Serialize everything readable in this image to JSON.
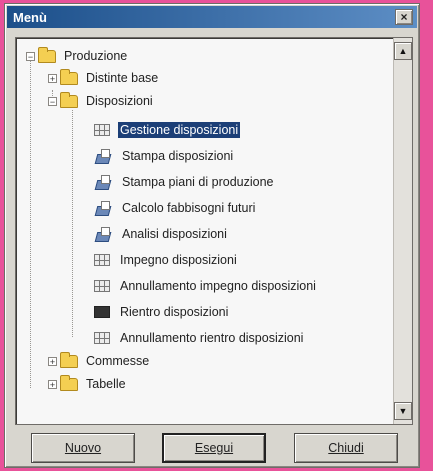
{
  "window": {
    "title": "Menù",
    "close_label": "×"
  },
  "tree": {
    "root": {
      "label": "Produzione",
      "expander": "−"
    },
    "distinte": {
      "label": "Distinte base",
      "expander": "+"
    },
    "disposizioni": {
      "label": "Disposizioni",
      "expander": "−"
    },
    "items": [
      {
        "label": "Gestione disposizioni",
        "icon": "grid-icon",
        "selected": true
      },
      {
        "label": "Stampa disposizioni",
        "icon": "print-icon"
      },
      {
        "label": "Stampa piani di produzione",
        "icon": "print-icon"
      },
      {
        "label": "Calcolo fabbisogni futuri",
        "icon": "print-icon"
      },
      {
        "label": "Analisi disposizioni",
        "icon": "print-icon"
      },
      {
        "label": "Impegno disposizioni",
        "icon": "grid-icon"
      },
      {
        "label": "Annullamento impegno disposizioni",
        "icon": "grid-icon"
      },
      {
        "label": "Rientro disposizioni",
        "icon": "dark-grid-icon"
      },
      {
        "label": "Annullamento rientro disposizioni",
        "icon": "grid-icon"
      }
    ],
    "commesse": {
      "label": "Commesse",
      "expander": "+"
    },
    "tabelle": {
      "label": "Tabelle",
      "expander": "+"
    }
  },
  "scrollbar": {
    "up": "▲",
    "down": "▼"
  },
  "buttons": {
    "nuovo": "Nuovo",
    "esegui": "Esegui",
    "chiudi": "Chiudi"
  }
}
